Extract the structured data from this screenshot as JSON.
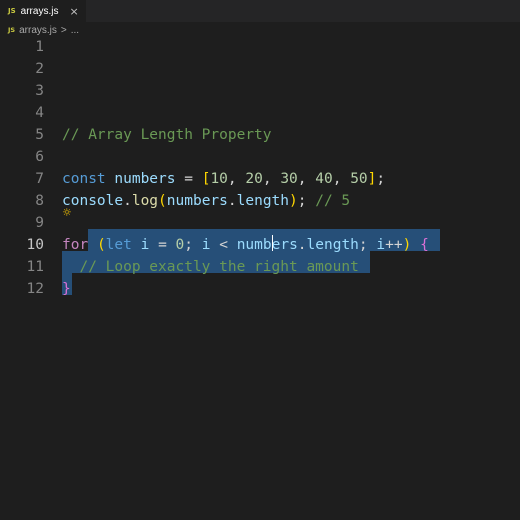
{
  "tab": {
    "icon": "JS",
    "title": "arrays.js",
    "close": "×"
  },
  "breadcrumb": {
    "icon": "JS",
    "file": "arrays.js",
    "separator": ">",
    "more": "..."
  },
  "lightbulb_icon": "lightbulb-icon",
  "editor": {
    "active_line": 10,
    "lines": [
      {
        "n": "1",
        "tokens": []
      },
      {
        "n": "2",
        "tokens": []
      },
      {
        "n": "3",
        "tokens": []
      },
      {
        "n": "4",
        "tokens": []
      },
      {
        "n": "5",
        "tokens": [
          {
            "t": "// Array Length Property",
            "c": "comment"
          }
        ]
      },
      {
        "n": "6",
        "tokens": []
      },
      {
        "n": "7",
        "tokens": [
          {
            "t": "const",
            "c": "kw"
          },
          {
            "t": " "
          },
          {
            "t": "numbers",
            "c": "var"
          },
          {
            "t": " = "
          },
          {
            "t": "[",
            "c": "br"
          },
          {
            "t": "10",
            "c": "num"
          },
          {
            "t": ", "
          },
          {
            "t": "20",
            "c": "num"
          },
          {
            "t": ", "
          },
          {
            "t": "30",
            "c": "num"
          },
          {
            "t": ", "
          },
          {
            "t": "40",
            "c": "num"
          },
          {
            "t": ", "
          },
          {
            "t": "50",
            "c": "num"
          },
          {
            "t": "]",
            "c": "br"
          },
          {
            "t": ";"
          }
        ]
      },
      {
        "n": "8",
        "tokens": [
          {
            "t": "console",
            "c": "var"
          },
          {
            "t": "."
          },
          {
            "t": "log",
            "c": "fn"
          },
          {
            "t": "(",
            "c": "br"
          },
          {
            "t": "numbers",
            "c": "var"
          },
          {
            "t": "."
          },
          {
            "t": "length",
            "c": "var"
          },
          {
            "t": ")",
            "c": "br"
          },
          {
            "t": "; "
          },
          {
            "t": "// 5",
            "c": "comment"
          }
        ]
      },
      {
        "n": "9",
        "tokens": []
      },
      {
        "n": "10",
        "tokens": [
          {
            "t": "for",
            "c": "ctl"
          },
          {
            "t": " "
          },
          {
            "t": "(",
            "c": "br"
          },
          {
            "t": "let",
            "c": "kw"
          },
          {
            "t": " "
          },
          {
            "t": "i",
            "c": "var"
          },
          {
            "t": " = "
          },
          {
            "t": "0",
            "c": "num"
          },
          {
            "t": "; "
          },
          {
            "t": "i",
            "c": "var"
          },
          {
            "t": " < "
          },
          {
            "t": "numbers",
            "c": "var"
          },
          {
            "t": "."
          },
          {
            "t": "length",
            "c": "var"
          },
          {
            "t": "; "
          },
          {
            "t": "i",
            "c": "var"
          },
          {
            "t": "++"
          },
          {
            "t": ")",
            "c": "br"
          },
          {
            "t": " "
          },
          {
            "t": "{",
            "c": "br2"
          }
        ]
      },
      {
        "n": "11",
        "tokens": [
          {
            "t": "  "
          },
          {
            "t": "// Loop exactly the right amount",
            "c": "comment"
          }
        ]
      },
      {
        "n": "12",
        "tokens": [
          {
            "t": "}",
            "c": "br2"
          }
        ]
      }
    ]
  },
  "colors": {
    "background": "#1e1e1e",
    "selection": "#264f78",
    "comment": "#6a9955",
    "keyword": "#569cd6",
    "control": "#c586c0",
    "variable": "#9cdcfe",
    "number": "#b5cea8",
    "function": "#dcdcaa",
    "bracket": "#ffd700"
  }
}
